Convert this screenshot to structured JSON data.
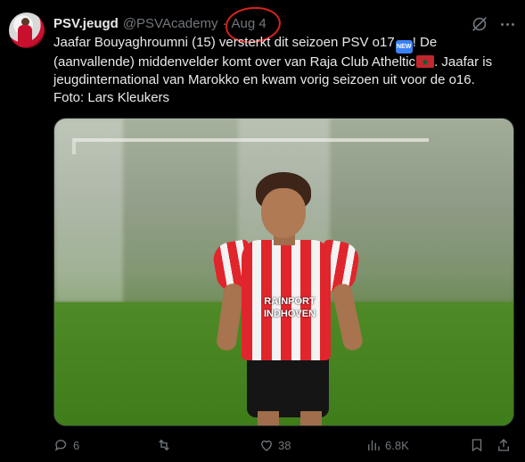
{
  "tweet": {
    "author_name": "PSV.jeugd",
    "handle": "@PSVAcademy",
    "separator": "·",
    "date": "Aug 4",
    "text_lines": {
      "l1_a": "Jaafar Bouyaghroumni (15) versterkt dit seizoen PSV o17",
      "l1_b": "! De",
      "l2_a": "(aanvallende) middenvelder komt over van Raja Club Atheltic",
      "l2_b": ". Jaafar is",
      "l3": "jeugdinternational van Marokko en kwam vorig seizoen uit voor de o16.",
      "l4": "Foto: Lars Kleukers"
    },
    "emoji_new_label": "NEW",
    "photo": {
      "sponsor_line1": "RAINPORT",
      "sponsor_line2": "INDHOVEN"
    }
  },
  "actions": {
    "replies": "6",
    "reposts": "",
    "likes": "38",
    "views": "6.8K"
  },
  "colors": {
    "annotation_circle": "#d8231d",
    "muted": "#71767b",
    "text": "#e7e9ea"
  },
  "icons": [
    "grok-icon",
    "more-icon",
    "reply-icon",
    "repost-icon",
    "like-icon",
    "views-icon",
    "bookmark-icon",
    "share-icon"
  ]
}
